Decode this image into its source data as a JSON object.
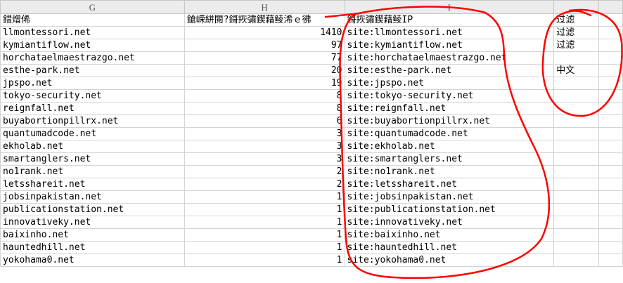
{
  "columns": [
    "G",
    "H",
    "I",
    "",
    ""
  ],
  "header_row": {
    "g": "錯熷俙",
    "h": "鎗嵘絣閱?鎶拻彇鍥藉鲮浠ｅ彿",
    "i": "鎶拻彇鍥藉鲮IP",
    "j": "过滤",
    "k": ""
  },
  "rows": [
    {
      "g": "llmontessori.net",
      "h": "1410",
      "i": "site:llmontessori.net",
      "j": "过滤"
    },
    {
      "g": "kymiantiflow.net",
      "h": "97",
      "i": "site:kymiantiflow.net",
      "j": "过滤"
    },
    {
      "g": "horchataelmaestrazgo.net",
      "h": "77",
      "i": "site:horchataelmaestrazgo.net",
      "j": ""
    },
    {
      "g": "esthe-park.net",
      "h": "20",
      "i": "site:esthe-park.net",
      "j": "中文"
    },
    {
      "g": "jpspo.net",
      "h": "19",
      "i": "site:jpspo.net",
      "j": ""
    },
    {
      "g": "tokyo-security.net",
      "h": "8",
      "i": "site:tokyo-security.net",
      "j": ""
    },
    {
      "g": "reignfall.net",
      "h": "8",
      "i": "site:reignfall.net",
      "j": ""
    },
    {
      "g": "buyabortionpillrx.net",
      "h": "6",
      "i": "site:buyabortionpillrx.net",
      "j": ""
    },
    {
      "g": "quantumadcode.net",
      "h": "3",
      "i": "site:quantumadcode.net",
      "j": ""
    },
    {
      "g": "ekholab.net",
      "h": "3",
      "i": "site:ekholab.net",
      "j": ""
    },
    {
      "g": "smartanglers.net",
      "h": "3",
      "i": "site:smartanglers.net",
      "j": ""
    },
    {
      "g": "no1rank.net",
      "h": "2",
      "i": "site:no1rank.net",
      "j": ""
    },
    {
      "g": "letsshareit.net",
      "h": "2",
      "i": "site:letsshareit.net",
      "j": ""
    },
    {
      "g": "jobsinpakistan.net",
      "h": "1",
      "i": "site:jobsinpakistan.net",
      "j": ""
    },
    {
      "g": "publicationstation.net",
      "h": "1",
      "i": "site:publicationstation.net",
      "j": ""
    },
    {
      "g": "innovativeky.net",
      "h": "1",
      "i": "site:innovativeky.net",
      "j": ""
    },
    {
      "g": "baixinho.net",
      "h": "1",
      "i": "site:baixinho.net",
      "j": ""
    },
    {
      "g": "hauntedhill.net",
      "h": "1",
      "i": "site:hauntedhill.net",
      "j": ""
    },
    {
      "g": "yokohama0.net",
      "h": "1",
      "i": "site:yokohama0.net",
      "j": ""
    }
  ],
  "annotation_color": "#ff0000"
}
